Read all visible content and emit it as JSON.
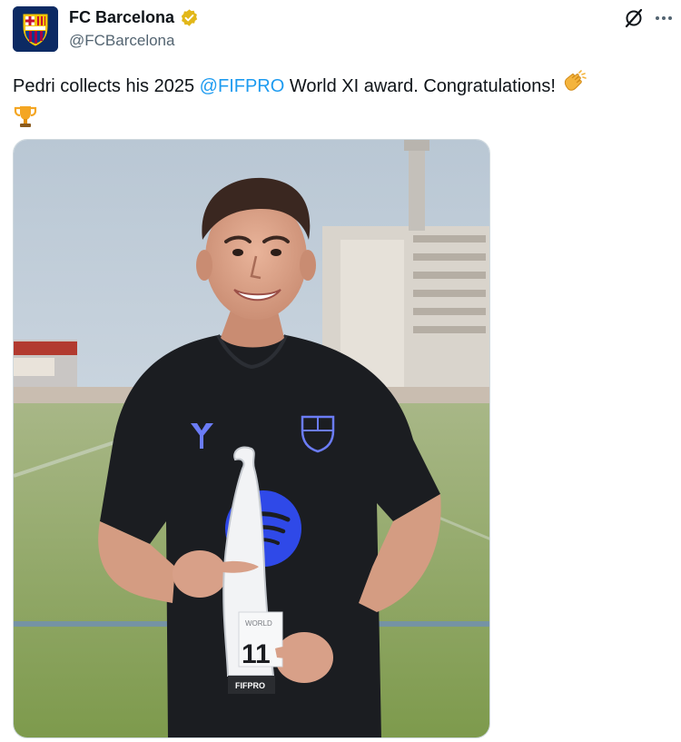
{
  "account": {
    "display_name": "FC Barcelona",
    "handle": "@FCBarcelona",
    "verified": true,
    "verified_badge_color": "#e2b719"
  },
  "tweet": {
    "text_before": "Pedri collects his 2025 ",
    "mention": "@FIFPRO",
    "text_after": " World XI award. Congratulations!",
    "emojis": [
      "clapping-hands",
      "trophy"
    ]
  },
  "media": {
    "trophy_label_top": "WORLD",
    "trophy_number": "11",
    "trophy_brand": "FIFPRO"
  },
  "colors": {
    "mention": "#1d9bf0",
    "text": "#0f1419",
    "secondary": "#536471",
    "club_blue": "#0c2a63",
    "club_red": "#a50044"
  },
  "icons": [
    "grok-icon",
    "more-options-icon",
    "verified-badge-icon",
    "club-crest-icon"
  ]
}
